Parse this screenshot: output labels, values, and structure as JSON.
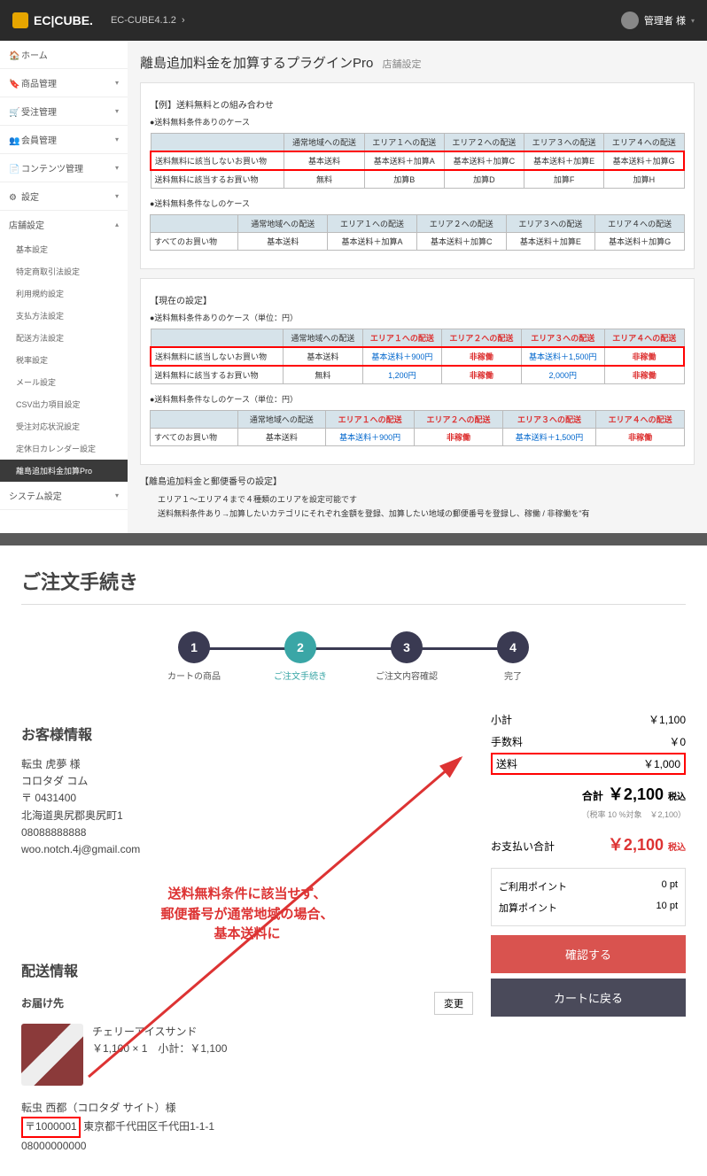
{
  "topbar": {
    "logo": "EC|CUBE.",
    "version": "EC-CUBE4.1.2",
    "user": "管理者 様"
  },
  "sidebar": {
    "items": [
      {
        "icon": "🏠",
        "label": "ホーム"
      },
      {
        "icon": "🔖",
        "label": "商品管理"
      },
      {
        "icon": "🛒",
        "label": "受注管理"
      },
      {
        "icon": "👥",
        "label": "会員管理"
      },
      {
        "icon": "📄",
        "label": "コンテンツ管理"
      },
      {
        "icon": "⚙",
        "label": "設定"
      }
    ],
    "sub_header": "店舗設定",
    "subs": [
      "基本設定",
      "特定商取引法設定",
      "利用規約設定",
      "支払方法設定",
      "配送方法設定",
      "税率設定",
      "メール設定",
      "CSV出力項目設定",
      "受注対応状況設定",
      "定休日カレンダー設定"
    ],
    "active_sub": "離島追加料金加算Pro",
    "system": "システム設定"
  },
  "page": {
    "title": "離島追加料金を加算するプラグインPro",
    "shop_label": "店舗設定"
  },
  "card1": {
    "header": "【例】送料無料との組み合わせ",
    "b1": "●送料無料条件ありのケース",
    "b2": "●送料無料条件なしのケース",
    "t1": {
      "h": [
        "",
        "通常地域への配送",
        "エリア１への配送",
        "エリア２への配送",
        "エリア３への配送",
        "エリア４への配送"
      ],
      "r1": [
        "送料無料に該当しないお買い物",
        "基本送料",
        "基本送料＋加算A",
        "基本送料＋加算C",
        "基本送料＋加算E",
        "基本送料＋加算G"
      ],
      "r2": [
        "送料無料に該当するお買い物",
        "無料",
        "加算B",
        "加算D",
        "加算F",
        "加算H"
      ]
    },
    "t2": {
      "h": [
        "",
        "通常地域への配送",
        "エリア１への配送",
        "エリア２への配送",
        "エリア３への配送",
        "エリア４への配送"
      ],
      "r1": [
        "すべてのお買い物",
        "基本送料",
        "基本送料＋加算A",
        "基本送料＋加算C",
        "基本送料＋加算E",
        "基本送料＋加算G"
      ]
    }
  },
  "card2": {
    "header": "【現在の設定】",
    "b1": "●送料無料条件ありのケース（単位：円）",
    "b2": "●送料無料条件なしのケース（単位：円）",
    "t1": {
      "h": [
        "",
        "通常地域への配送",
        "エリア１への配送",
        "エリア２への配送",
        "エリア３への配送",
        "エリア４への配送"
      ],
      "r1": [
        "送料無料に該当しないお買い物",
        "基本送料",
        "基本送料＋900円",
        "非稼働",
        "基本送料＋1,500円",
        "非稼働"
      ],
      "r2": [
        "送料無料に該当するお買い物",
        "無料",
        "1,200円",
        "非稼働",
        "2,000円",
        "非稼働"
      ]
    },
    "t2": {
      "h": [
        "",
        "通常地域への配送",
        "エリア１への配送",
        "エリア２への配送",
        "エリア３への配送",
        "エリア４への配送"
      ],
      "r1": [
        "すべてのお買い物",
        "基本送料",
        "基本送料＋900円",
        "非稼働",
        "基本送料＋1,500円",
        "非稼働"
      ]
    }
  },
  "card3": {
    "header": "【離島追加料金と郵便番号の設定】",
    "line1": "エリア１～エリア４まで４種類のエリアを設定可能です",
    "line2": "送料無料条件あり→加算したいカテゴリにそれぞれ金額を登録、加算したい地域の郵便番号を登録し、稼働 / 非稼働を\"有"
  },
  "checkout": {
    "title": "ご注文手続き",
    "steps": [
      "カートの商品",
      "ご注文手続き",
      "ご注文内容確認",
      "完了"
    ],
    "customer": {
      "title": "お客様情報",
      "name": "転虫 虎夢 様",
      "kana": "コロタダ コム",
      "postal": "〒 0431400",
      "address": "北海道奥尻郡奥尻町1",
      "tel": "08088888888",
      "email": "woo.notch.4j@gmail.com"
    },
    "delivery": {
      "title": "配送情報",
      "subtitle": "お届け先",
      "change": "変更",
      "item_name": "チェリーアイスサンド",
      "item_line": "￥1,100 × 1　小計：￥1,100",
      "recipient": "転虫 西都（コロタダ サイト）様",
      "postal": "〒1000001",
      "address": "東京都千代田区千代田1-1-1",
      "tel": "08000000000"
    },
    "totals": {
      "subtotal_l": "小計",
      "subtotal_v": "￥1,100",
      "fee_l": "手数料",
      "fee_v": "￥0",
      "ship_l": "送料",
      "ship_v": "￥1,000",
      "grand_l": "合計",
      "grand_v": "￥2,100",
      "tax": "税込",
      "tax_note": "（税率 10 %対象　￥2,100）",
      "pay_l": "お支払い合計",
      "pay_v": "￥2,100",
      "pay_tax": "税込"
    },
    "points": {
      "use_l": "ご利用ポイント",
      "use_v": "0 pt",
      "add_l": "加算ポイント",
      "add_v": "10 pt"
    },
    "buttons": {
      "confirm": "確認する",
      "back": "カートに戻る"
    },
    "annotation": "送料無料条件に該当せず、\n郵便番号が通常地域の場合、\n基本送料に"
  }
}
